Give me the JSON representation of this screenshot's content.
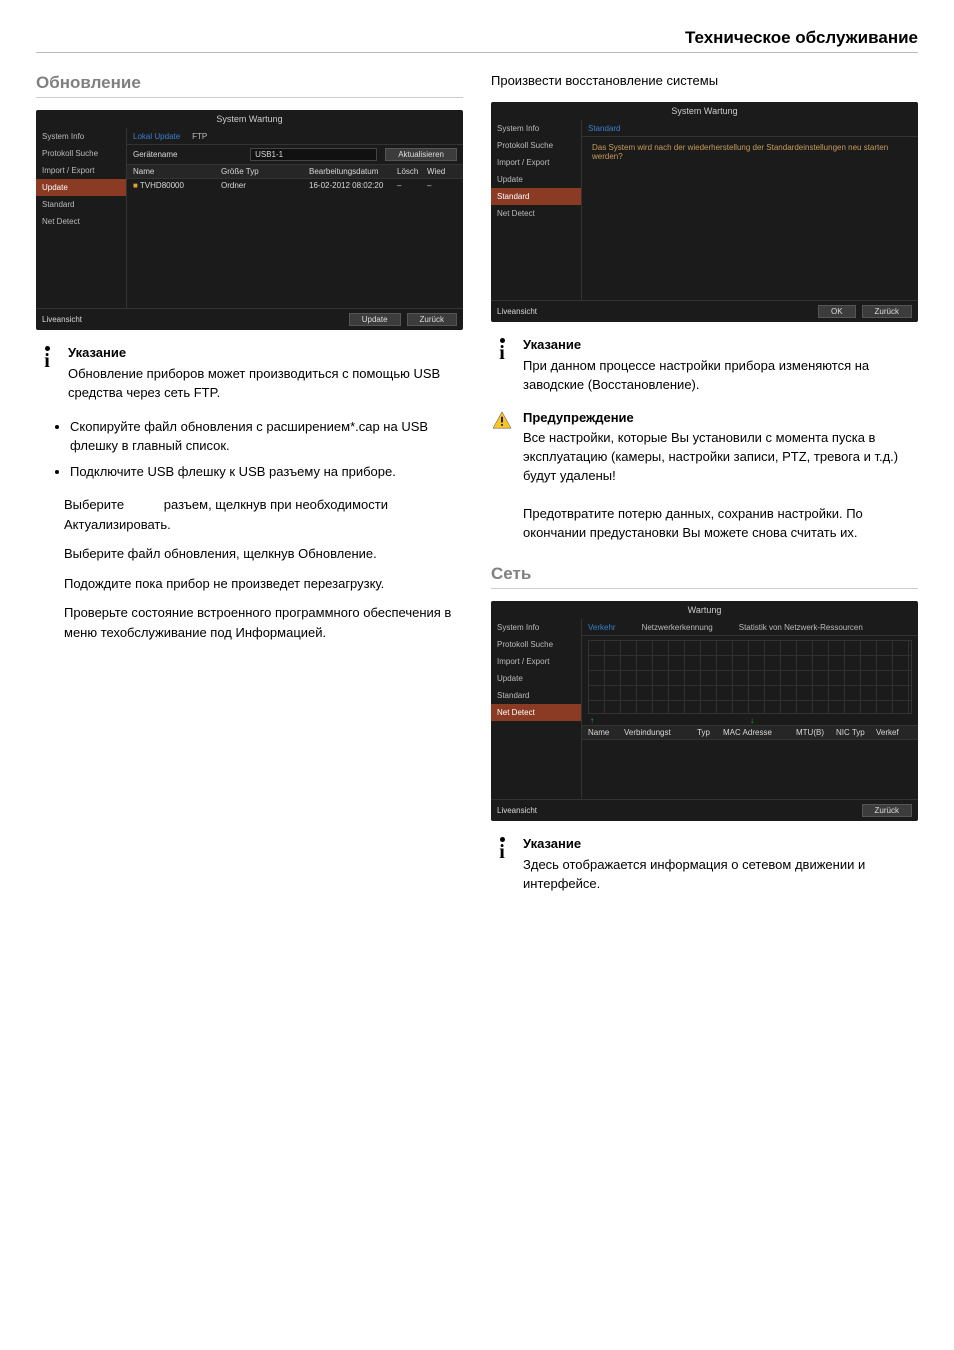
{
  "header_title": "Техническое обслуживание",
  "left": {
    "section": "Обновление",
    "shot": {
      "title": "System Wartung",
      "nav": [
        "System Info",
        "Protokoll Suche",
        "Import / Export",
        "Update",
        "Standard",
        "Net Detect"
      ],
      "nav_active": 3,
      "tabs": [
        "Lokal Update",
        "FTP"
      ],
      "tab_active": 0,
      "device_label": "Gerätename",
      "device_value": "USB1-1",
      "refresh": "Aktualisieren",
      "cols": [
        "Name",
        "Größe Typ",
        "Bearbeitungsdatum",
        "Lösch",
        "Wied"
      ],
      "row": [
        "TVHD80000",
        "Ordner",
        "16-02-2012 08:02:20",
        "–",
        "–"
      ],
      "liveview": "Liveansicht",
      "btn_update": "Update",
      "btn_back": "Zurück"
    },
    "note_title": "Указание",
    "note_body": "Обновление приборов может производиться с помощью USB средства через сеть FTP.",
    "bul1": "Скопируйте файл обновления с расширением*.cap на USB флешку в главный список.",
    "bul2": "Подключите USB флешку к USB разъему на приборе.",
    "p1": "Выберите           разъем, щелкнув при необходимости Актуализировать.",
    "p2": "Выберите файл обновления, щелкнув Обновление.",
    "p3": "Подождите пока прибор не произведет перезагрузку.",
    "p4": "Проверьте состояние встроенного программного обеспечения в меню техобслуживание под Информацией."
  },
  "right": {
    "intro": "Произвести восстановление системы",
    "shot1": {
      "title": "System Wartung",
      "nav": [
        "System Info",
        "Protokoll Suche",
        "Import / Export",
        "Update",
        "Standard",
        "Net Detect"
      ],
      "nav_active": 4,
      "tab": "Standard",
      "msg": "Das System wird nach der wiederherstellung der Standardeinstellungen neu starten werden?",
      "liveview": "Liveansicht",
      "btn_ok": "OK",
      "btn_back": "Zurück"
    },
    "note1_title": "Указание",
    "note1_body": "При данном процессе настройки прибора изменяются на заводские (Восстановление).",
    "warn_title": "Предупреждение",
    "warn_body1": "Все настройки, которые Вы установили с момента пуска в эксплуатацию (камеры, настройки записи, PTZ, тревога и т.д.) будут удалены!",
    "warn_body2": "Предотвратите потерю данных, сохранив настройки. По окончании предустановки Вы можете снова считать их.",
    "section_net": "Сеть",
    "shot2": {
      "title": "Wartung",
      "nav": [
        "System Info",
        "Protokoll Suche",
        "Import / Export",
        "Update",
        "Standard",
        "Net Detect"
      ],
      "nav_active": 5,
      "tabs": [
        "Verkehr",
        "Netzwerkerkennung",
        "Statistik von Netzwerk-Ressourcen"
      ],
      "tab_active": 0,
      "cols": [
        "Name",
        "Verbindungst",
        "Typ",
        "MAC Adresse",
        "MTU(B)",
        "NIC Typ",
        "Verkef"
      ],
      "liveview": "Liveansicht",
      "btn_back": "Zurück"
    },
    "note2_title": "Указание",
    "note2_body": "Здесь отображается информация о сетевом движении и интерфейсе."
  }
}
